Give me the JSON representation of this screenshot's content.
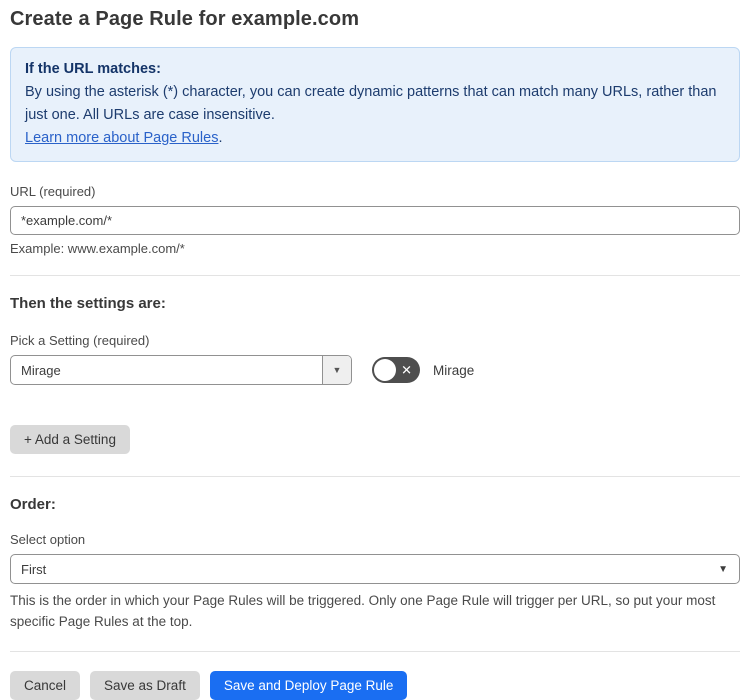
{
  "page": {
    "title": "Create a Page Rule for example.com"
  },
  "info_box": {
    "heading": "If the URL matches:",
    "body": "By using the asterisk (*) character, you can create dynamic patterns that can match many URLs, rather than just one. All URLs are case insensitive.",
    "link_label": "Learn more about Page Rules",
    "link_suffix": "."
  },
  "url_field": {
    "label": "URL (required)",
    "value": "*example.com/*",
    "example": "Example: www.example.com/*"
  },
  "settings_section": {
    "heading": "Then the settings are:",
    "picker_label": "Pick a Setting (required)",
    "selected_setting": "Mirage",
    "toggle_label": "Mirage",
    "toggle_state": "off",
    "add_button_label": "+ Add a Setting"
  },
  "order_section": {
    "heading": "Order:",
    "label": "Select option",
    "selected_option": "First",
    "help_text": "This is the order in which your Page Rules will be triggered. Only one Page Rule will trigger per URL, so put your most specific Page Rules at the top."
  },
  "actions": {
    "cancel_label": "Cancel",
    "save_draft_label": "Save as Draft",
    "deploy_label": "Save and Deploy Page Rule"
  },
  "icons": {
    "select_caret": "▼",
    "toggle_off_x": "✕"
  },
  "colors": {
    "accent_blue": "#1a6ef2",
    "info_background": "#e8f1fb",
    "info_border": "#bcd7f3",
    "info_text": "#1d3c6e",
    "link_blue": "#2a62c9",
    "toggle_off_background": "#4e4e4e",
    "button_gray": "#d9d9d9"
  }
}
